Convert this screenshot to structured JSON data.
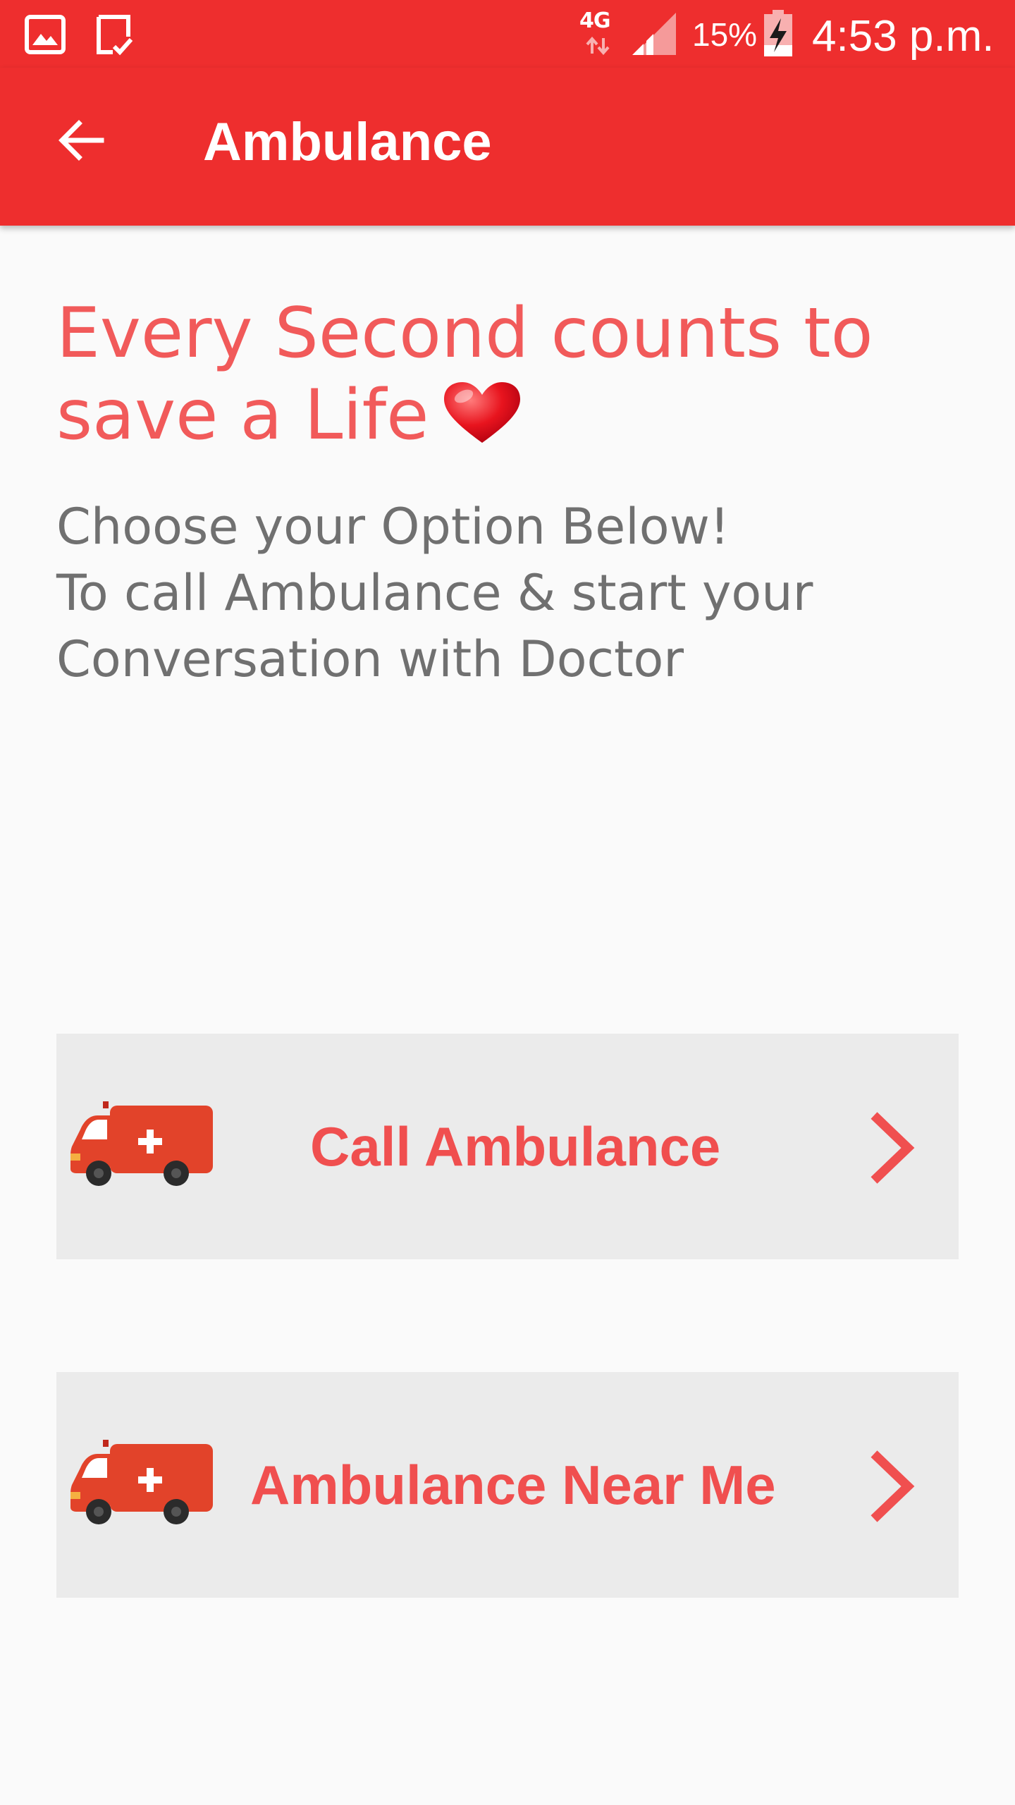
{
  "status_bar": {
    "network": "4G",
    "battery": "15%",
    "time": "4:53 p.m.",
    "icons": [
      "gallery-icon",
      "clipboard-check-icon",
      "network-arrows-icon",
      "signal-icon",
      "battery-charging-icon"
    ]
  },
  "toolbar": {
    "title": "Ambulance",
    "back_icon": "arrow-left-icon"
  },
  "main": {
    "headline": "Every Second counts to save a Life",
    "headline_icon": "heart-icon",
    "subtext_line1": "Choose your Option Below!",
    "subtext_line2": "To call Ambulance & start your",
    "subtext_line3": "Conversation with Doctor",
    "options": [
      {
        "label": "Call Ambulance",
        "icon": "ambulance-icon",
        "chevron": "chevron-right-icon"
      },
      {
        "label": "Ambulance Near Me",
        "icon": "ambulance-icon",
        "chevron": "chevron-right-icon"
      }
    ]
  },
  "colors": {
    "primary": "#ee2e2e",
    "accent_text": "#f15a5a",
    "body_text": "#707070",
    "card_bg": "#ebebeb",
    "page_bg": "#fafafa"
  }
}
